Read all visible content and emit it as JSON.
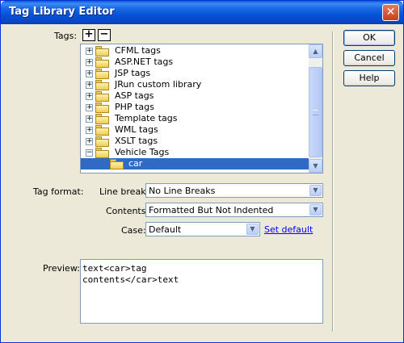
{
  "window": {
    "title": "Tag Library Editor",
    "close_glyph": "✕"
  },
  "tags": {
    "label": "Tags:",
    "add_glyph": "+",
    "remove_glyph": "−",
    "items": [
      {
        "label": "CFML tags",
        "expander": "+"
      },
      {
        "label": "ASP.NET tags",
        "expander": "+"
      },
      {
        "label": "JSP tags",
        "expander": "+"
      },
      {
        "label": "JRun custom library",
        "expander": "+"
      },
      {
        "label": "ASP tags",
        "expander": "+"
      },
      {
        "label": "PHP tags",
        "expander": "+"
      },
      {
        "label": "Template tags",
        "expander": "+"
      },
      {
        "label": "WML tags",
        "expander": "+"
      },
      {
        "label": "XSLT tags",
        "expander": "+"
      },
      {
        "label": "Vehicle Tags",
        "expander": "−"
      }
    ],
    "child": {
      "label": "car",
      "selected": true
    },
    "scroll_up_glyph": "▲",
    "scroll_down_glyph": "▼"
  },
  "format": {
    "label": "Tag format:",
    "line_breaks": {
      "label": "Line breaks:",
      "value": "No Line Breaks"
    },
    "contents": {
      "label": "Contents:",
      "value": "Formatted But Not Indented"
    },
    "case": {
      "label": "Case:",
      "value": "Default",
      "set_default": "Set default"
    },
    "arrow_glyph": "▼"
  },
  "preview": {
    "label": "Preview:",
    "lines": [
      "text<car>tag",
      "contents</car>text"
    ]
  },
  "buttons": {
    "ok": "OK",
    "cancel": "Cancel",
    "help": "Help"
  },
  "colors": {
    "selection": "#316ac5",
    "link": "#0000ff",
    "titlebar": "#0a5ad4"
  }
}
